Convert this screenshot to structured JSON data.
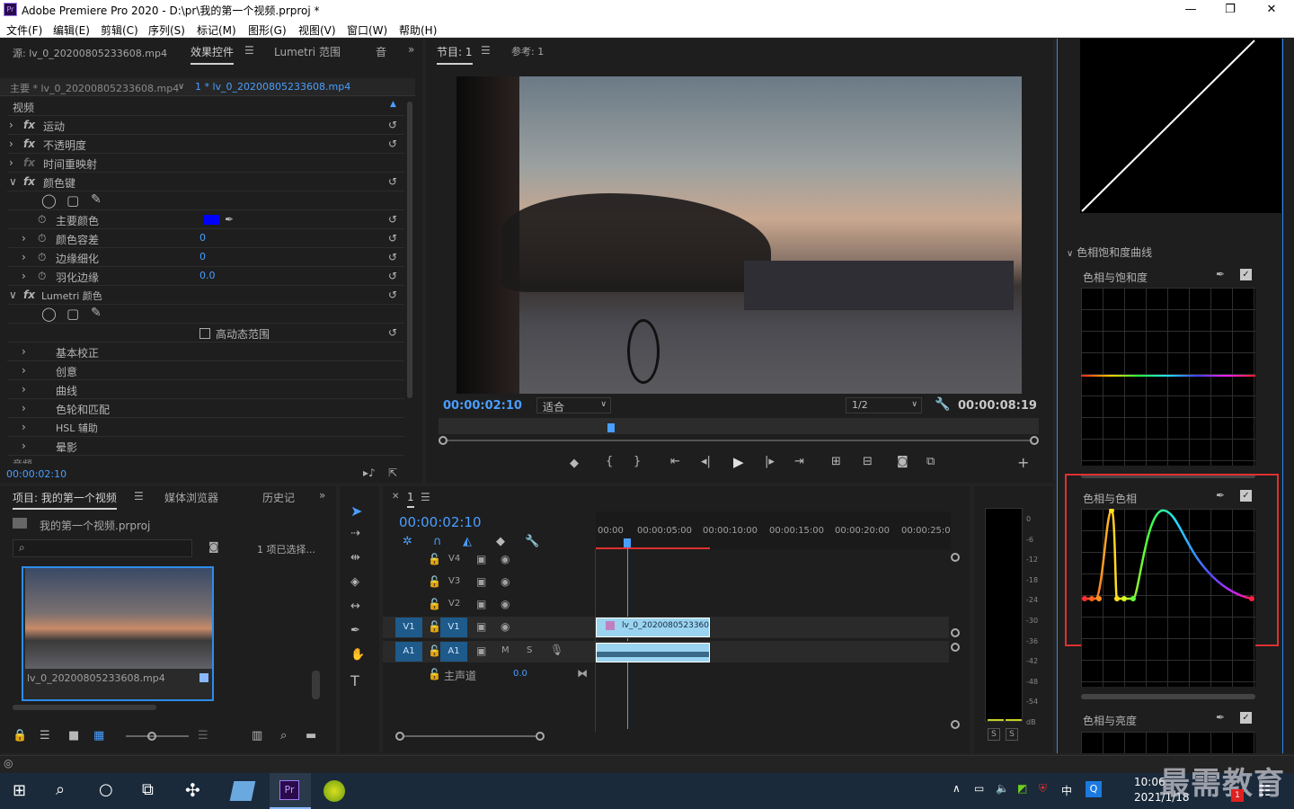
{
  "window": {
    "title": "Adobe Premiere Pro 2020 - D:\\pr\\我的第一个视频.prproj *",
    "logo": "Pr",
    "min": "—",
    "max": "❐",
    "close": "✕"
  },
  "menu": [
    "文件(F)",
    "编辑(E)",
    "剪辑(C)",
    "序列(S)",
    "标记(M)",
    "图形(G)",
    "视图(V)",
    "窗口(W)",
    "帮助(H)"
  ],
  "source_panel": {
    "tabs": [
      "源: lv_0_20200805233608.mp4",
      "效果控件",
      "Lumetri 范围",
      "音"
    ],
    "master": "主要 * lv_0_20200805233608.mp4",
    "sequence_clip": "1 * lv_0_20200805233608.mp4",
    "section_video": "视频",
    "effects": [
      "运动",
      "不透明度",
      "时间重映射",
      "颜色键"
    ],
    "color_key": {
      "main_color": "主要颜色",
      "tolerance": "颜色容差",
      "tolerance_val": "0",
      "edge_thin": "边缘细化",
      "edge_thin_val": "0",
      "feather": "羽化边缘",
      "feather_val": "0.0",
      "main_color_hex": "#0000ff"
    },
    "lumetri": "Lumetri 颜色",
    "hdr": "高动态范围",
    "lumetri_items": [
      "基本校正",
      "创意",
      "曲线",
      "色轮和匹配",
      "HSL 辅助",
      "晕影"
    ],
    "audio_label": "音频",
    "timecode": "00:00:02:10"
  },
  "program": {
    "tabs": [
      "节目: 1",
      "参考: 1"
    ],
    "timecode": "00:00:02:10",
    "fit": "适合",
    "quality": "1/2",
    "duration": "00:00:08:19"
  },
  "project": {
    "tabs": [
      "项目: 我的第一个视频",
      "媒体浏览器",
      "历史记"
    ],
    "file": "我的第一个视频.prproj",
    "selection": "1 项已选择...",
    "clip_name": "lv_0_20200805233608.mp4"
  },
  "timeline": {
    "tab": "1",
    "timecode": "00:00:02:10",
    "ruler": [
      "00:00",
      "00:00:05:00",
      "00:00:10:00",
      "00:00:15:00",
      "00:00:20:00",
      "00:00:25:00"
    ],
    "tracks": [
      "V4",
      "V3",
      "V2",
      "V1",
      "A1"
    ],
    "src_v1": "V1",
    "src_a1": "A1",
    "master": "主声道",
    "master_val": "0.0",
    "clip_label": "lv_0_2020080523360",
    "m": "M",
    "s": "S"
  },
  "meter": {
    "scale": [
      "0",
      "-6",
      "-12",
      "-18",
      "-24",
      "-30",
      "-36",
      "-42",
      "-48",
      "-54",
      "dB"
    ],
    "s1": "S",
    "s2": "S"
  },
  "lumetri_panel": {
    "section": "色相饱和度曲线",
    "curve1": "色相与饱和度",
    "curve2": "色相与色相",
    "curve3": "色相与亮度"
  },
  "taskbar": {
    "time": "10:06",
    "date": "2021/1/18",
    "ime": "中",
    "watermark": "最需教育",
    "badge": "1"
  },
  "accent": "#2d8ceb",
  "highlight": "#e03030"
}
